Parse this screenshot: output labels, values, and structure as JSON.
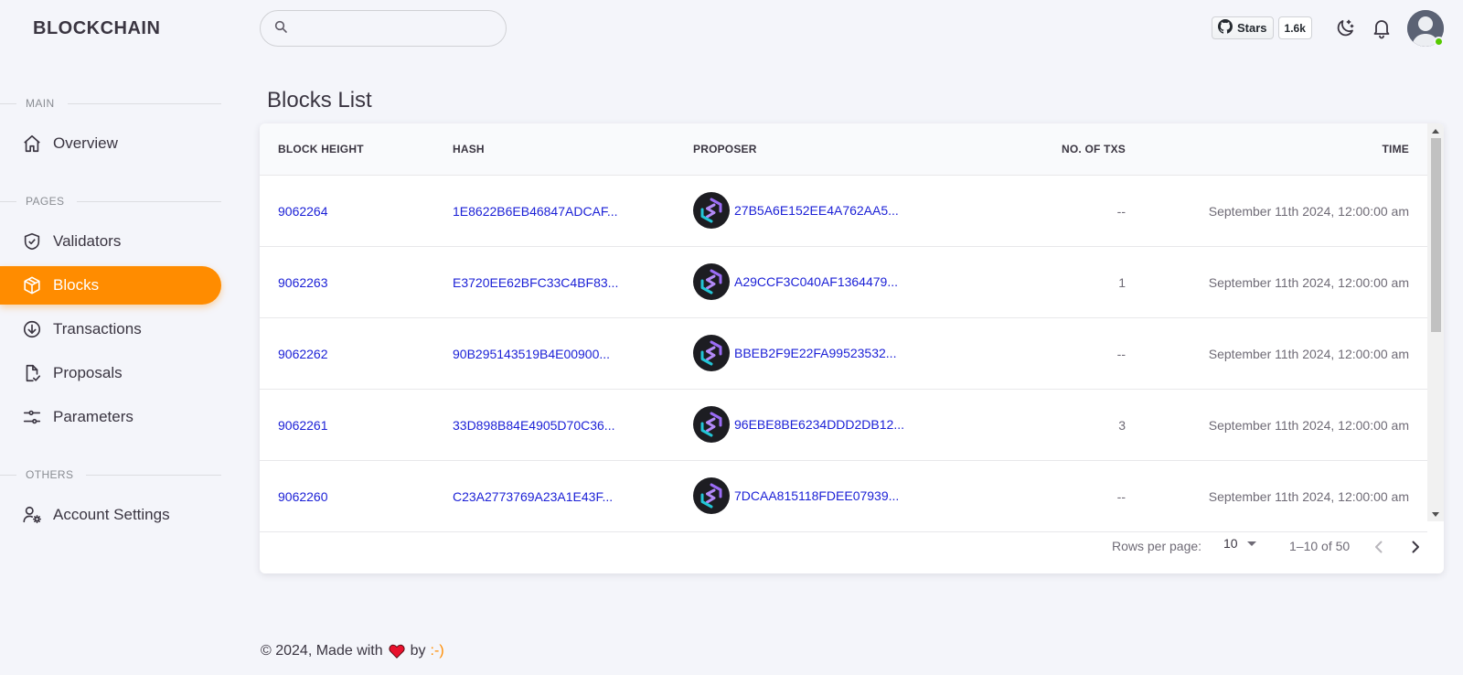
{
  "brand": "BLOCKCHAIN",
  "search": {
    "placeholder": ""
  },
  "github": {
    "label": "Stars",
    "count": "1.6k"
  },
  "sidebar": {
    "sections": {
      "main": "MAIN",
      "pages": "PAGES",
      "others": "OTHERS"
    },
    "items": [
      {
        "label": "Overview",
        "icon": "home-icon"
      },
      {
        "label": "Validators",
        "icon": "shield-check-icon"
      },
      {
        "label": "Blocks",
        "icon": "cube-icon",
        "active": true
      },
      {
        "label": "Transactions",
        "icon": "arrow-down-circle-icon"
      },
      {
        "label": "Proposals",
        "icon": "file-check-icon"
      },
      {
        "label": "Parameters",
        "icon": "sliders-icon"
      },
      {
        "label": "Account Settings",
        "icon": "user-cog-icon"
      }
    ]
  },
  "page": {
    "title": "Blocks List"
  },
  "table": {
    "headers": [
      "BLOCK HEIGHT",
      "HASH",
      "PROPOSER",
      "NO. OF TXS",
      "TIME"
    ],
    "rows": [
      {
        "height": "9062264",
        "hash": "1E8622B6EB46847ADCAF...",
        "proposer": "27B5A6E152EE4A762AA5...",
        "txs": "--",
        "time": "September 11th 2024, 12:00:00 am"
      },
      {
        "height": "9062263",
        "hash": "E3720EE62BFC33C4BF83...",
        "proposer": "A29CCF3C040AF1364479...",
        "txs": "1",
        "time": "September 11th 2024, 12:00:00 am"
      },
      {
        "height": "9062262",
        "hash": "90B295143519B4E00900...",
        "proposer": "BBEB2F9E22FA99523532...",
        "txs": "--",
        "time": "September 11th 2024, 12:00:00 am"
      },
      {
        "height": "9062261",
        "hash": "33D898B84E4905D70C36...",
        "proposer": "96EBE8BE6234DDD2DB12...",
        "txs": "3",
        "time": "September 11th 2024, 12:00:00 am"
      },
      {
        "height": "9062260",
        "hash": "C23A2773769A23A1E43F...",
        "proposer": "7DCAA815118FDEE07939...",
        "txs": "--",
        "time": "September 11th 2024, 12:00:00 am"
      }
    ]
  },
  "pagination": {
    "rows_label": "Rows per page:",
    "rows_value": "10",
    "range": "1–10 of 50"
  },
  "footer": {
    "prefix": "© 2024, Made with",
    "by": "by",
    "author": ":-)"
  },
  "colors": {
    "accent": "#ff8c00",
    "link": "#1a1fd6",
    "online": "#56ca00"
  }
}
